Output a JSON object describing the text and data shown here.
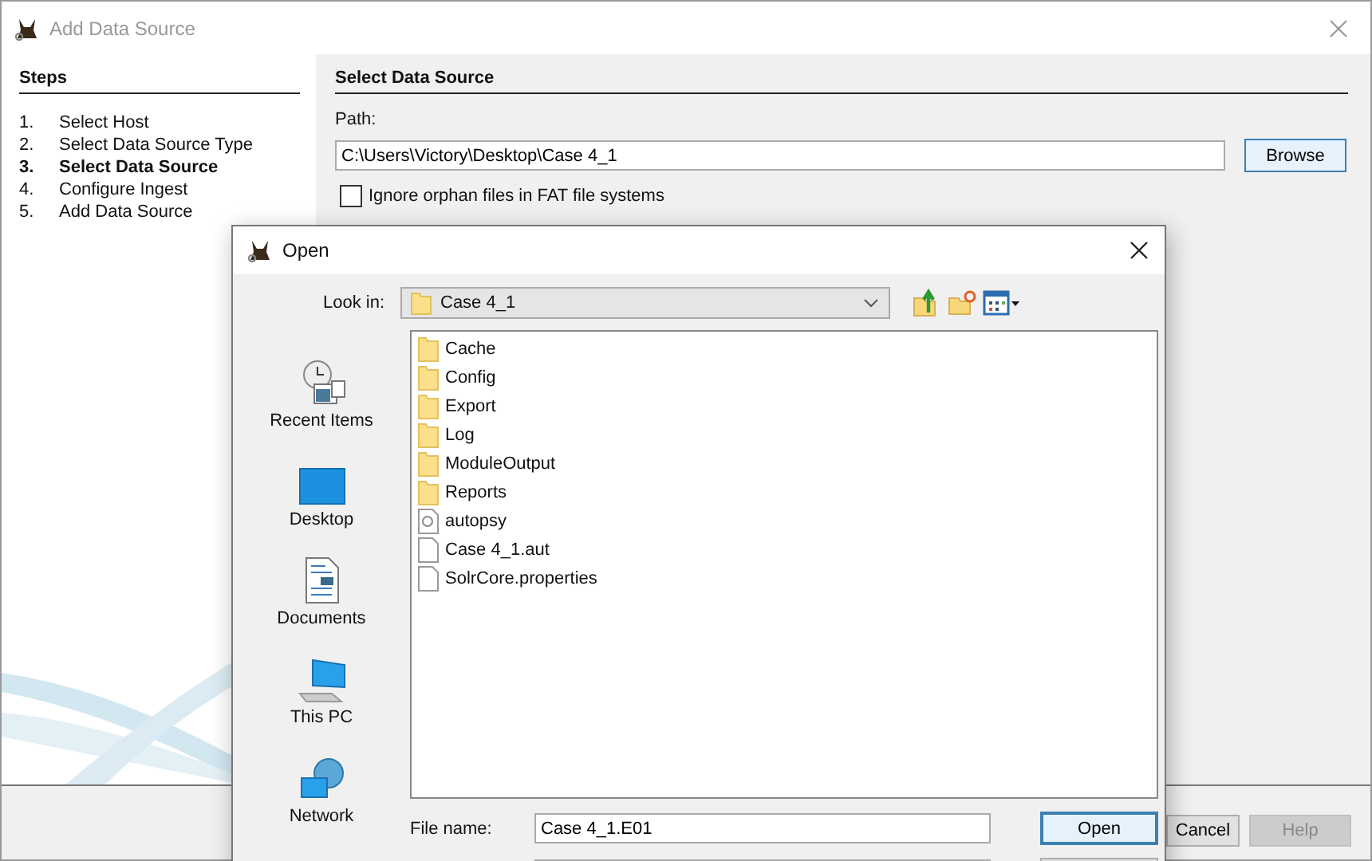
{
  "window": {
    "title": "Add Data Source"
  },
  "steps": {
    "title": "Steps",
    "items": [
      {
        "number": "1.",
        "label": "Select Host",
        "selected": false
      },
      {
        "number": "2.",
        "label": "Select Data Source Type",
        "selected": false
      },
      {
        "number": "3.",
        "label": "Select Data Source",
        "selected": true
      },
      {
        "number": "4.",
        "label": "Configure Ingest",
        "selected": false
      },
      {
        "number": "5.",
        "label": "Add Data Source",
        "selected": false
      }
    ]
  },
  "panel": {
    "title": "Select Data Source",
    "path_label": "Path:",
    "path_value": "C:\\Users\\Victory\\Desktop\\Case 4_1",
    "browse_button": "Browse",
    "orphan_checkbox": {
      "label": "Ignore orphan files in FAT file systems",
      "checked": false
    }
  },
  "footer_buttons": [
    {
      "label": "Cancel",
      "disabled": false
    },
    {
      "label": "Help",
      "disabled": true
    }
  ],
  "open_dialog": {
    "title": "Open",
    "look_in_label": "Look in:",
    "look_in_value": "Case 4_1",
    "places": [
      {
        "label": "Recent Items",
        "kind": "recent"
      },
      {
        "label": "Desktop",
        "kind": "desktop"
      },
      {
        "label": "Documents",
        "kind": "documents"
      },
      {
        "label": "This PC",
        "kind": "pc"
      },
      {
        "label": "Network",
        "kind": "network"
      }
    ],
    "files": [
      {
        "name": "Cache",
        "kind": "folder"
      },
      {
        "name": "Config",
        "kind": "folder"
      },
      {
        "name": "Export",
        "kind": "folder"
      },
      {
        "name": "Log",
        "kind": "folder"
      },
      {
        "name": "ModuleOutput",
        "kind": "folder"
      },
      {
        "name": "Reports",
        "kind": "folder"
      },
      {
        "name": "autopsy",
        "kind": "link"
      },
      {
        "name": "Case 4_1.aut",
        "kind": "file"
      },
      {
        "name": "SolrCore.properties",
        "kind": "file"
      }
    ],
    "file_name_label": "File name:",
    "file_name_value": "Case 4_1.E01",
    "open_button": "Open"
  }
}
